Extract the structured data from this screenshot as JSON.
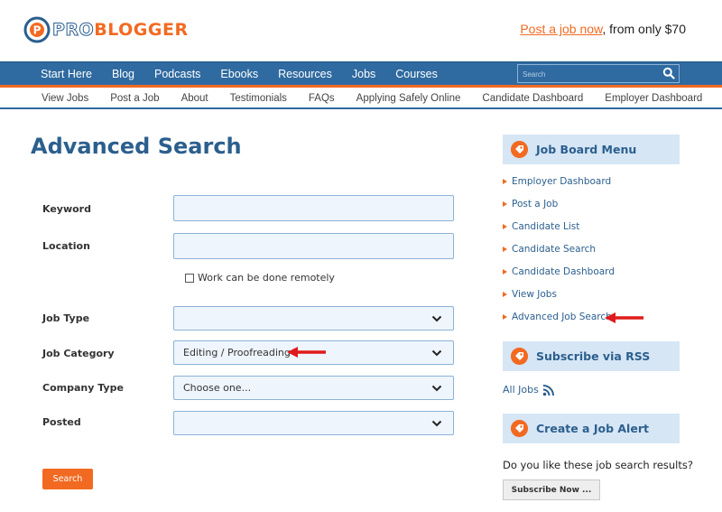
{
  "header": {
    "logo_pro": "PRO",
    "logo_blogger": "BLOGGER",
    "promo_link": "Post a job now",
    "promo_suffix": ", from only $70"
  },
  "main_nav": {
    "items": [
      "Start Here",
      "Blog",
      "Podcasts",
      "Ebooks",
      "Resources",
      "Jobs",
      "Courses"
    ],
    "search_placeholder": "Search"
  },
  "sub_nav": {
    "items": [
      "View Jobs",
      "Post a Job",
      "About",
      "Testimonials",
      "FAQs",
      "Applying Safely Online",
      "Candidate Dashboard",
      "Employer Dashboard"
    ]
  },
  "form": {
    "title": "Advanced Search",
    "keyword_label": "Keyword",
    "keyword_value": "",
    "location_label": "Location",
    "location_value": "",
    "remote_label": "Work can be done remotely",
    "job_type_label": "Job Type",
    "job_type_value": "",
    "job_category_label": "Job Category",
    "job_category_value": "Editing / Proofreading",
    "company_type_label": "Company Type",
    "company_type_value": "Choose one...",
    "posted_label": "Posted",
    "posted_value": "",
    "submit_label": "Search"
  },
  "sidebar": {
    "menu_title": "Job Board Menu",
    "menu_items": [
      "Employer Dashboard",
      "Post a Job",
      "Candidate List",
      "Candidate Search",
      "Candidate Dashboard",
      "View Jobs",
      "Advanced Job Search"
    ],
    "rss_title": "Subscribe via RSS",
    "rss_link": "All Jobs",
    "alert_title": "Create a Job Alert",
    "alert_question": "Do you like these job search results?",
    "subscribe_label": "Subscribe Now ..."
  },
  "colors": {
    "brand_blue": "#2f6aa0",
    "brand_orange": "#f26a21",
    "annotation_red": "#e01b1b"
  }
}
